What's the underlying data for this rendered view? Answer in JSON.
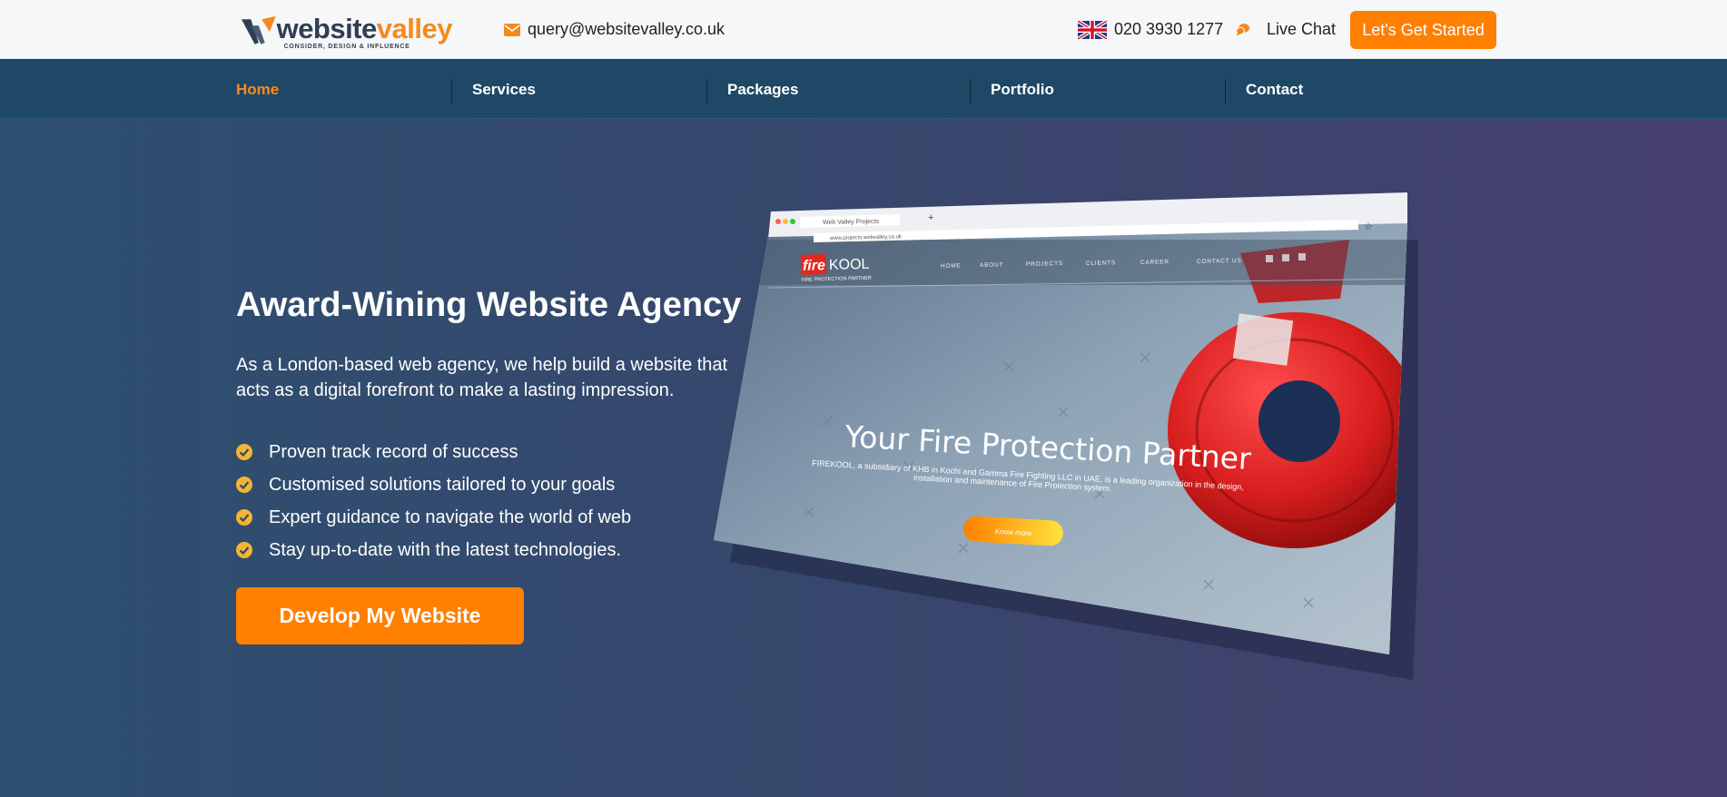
{
  "header": {
    "logo": {
      "primary": "website",
      "accent": "valley",
      "tagline": "CONSIDER, DESIGN & INFLUENCE"
    },
    "email": "query@websitevalley.co.uk",
    "phone": "020 3930 1277",
    "live_chat": "Live Chat",
    "cta_label": "Let's Get Started"
  },
  "nav": {
    "items": [
      {
        "label": "Home",
        "active": true
      },
      {
        "label": "Services",
        "active": false
      },
      {
        "label": "Packages",
        "active": false
      },
      {
        "label": "Portfolio",
        "active": false
      },
      {
        "label": "Contact",
        "active": false
      }
    ]
  },
  "hero": {
    "title": "Award-Wining Website Agency",
    "description": "As a London-based web agency, we help build a website that acts as a digital forefront to make a lasting impression.",
    "features": [
      "Proven track record of success",
      "Customised solutions tailored to your goals",
      "Expert guidance to navigate the world of web",
      "Stay up-to-date with the latest technologies."
    ],
    "cta_label": "Develop My Website"
  },
  "mockup": {
    "tab_title": "Web Valley Projects",
    "url": "www.projects.webvalley.co.uk",
    "brand_fire": "fire",
    "brand_kool": "KOOL",
    "brand_tagline": "FIRE PROTECTION PARTNER",
    "menu": [
      "HOME",
      "ABOUT",
      "PROJECTS",
      "CLIENTS",
      "CAREER",
      "CONTACT US"
    ],
    "headline": "Your Fire Protection Partner",
    "body_line1": "FIREKOOL, a subsidiary of KHB in Kochi and Gamma Fire Fighting LLC in UAE, is a leading organization in the design,",
    "body_line2": "installation and maintenance of Fire Protection system.",
    "button": "Know more"
  },
  "colors": {
    "accent_orange": "#ff7f00",
    "nav_bg": "#1f4866",
    "check_yellow": "#f5b431"
  }
}
